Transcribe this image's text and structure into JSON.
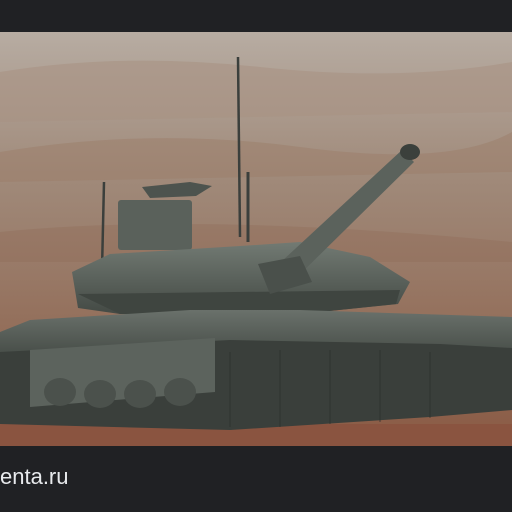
{
  "image": {
    "subject": "tank-photo",
    "palette": {
      "sky_haze": "#b9aea3",
      "hills": "#9a8574",
      "dirt": "#8a5a44",
      "tank_hull": "#4b524c",
      "tank_dark": "#2e332f",
      "frame_bg": "#202124"
    }
  },
  "caption": {
    "source_text": "enta.ru"
  }
}
